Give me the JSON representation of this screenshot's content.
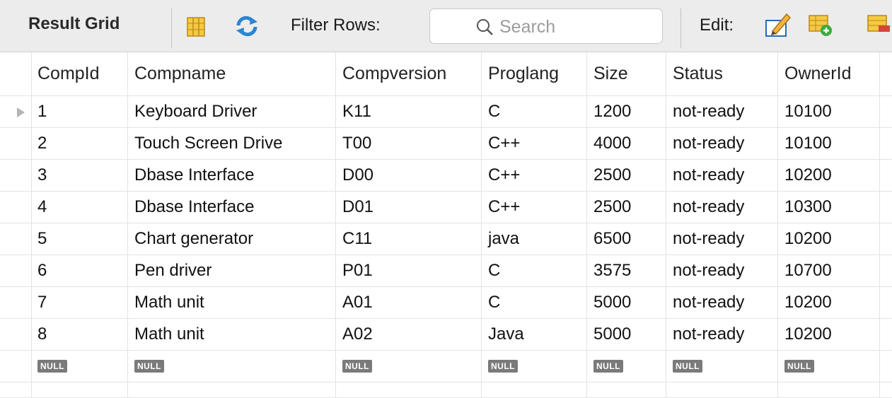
{
  "toolbar": {
    "title": "Result Grid",
    "filter_label": "Filter Rows:",
    "search_placeholder": "Search",
    "edit_label": "Edit:",
    "icons": [
      "grid-columns-icon",
      "refresh-icon",
      "search-icon",
      "edit-pencil-icon",
      "add-row-icon",
      "delete-row-icon"
    ]
  },
  "grid": {
    "columns": [
      "CompId",
      "Compname",
      "Compversion",
      "Proglang",
      "Size",
      "Status",
      "OwnerId"
    ],
    "rows": [
      [
        "1",
        "Keyboard Driver",
        "K11",
        "C",
        "1200",
        "not-ready",
        "10100"
      ],
      [
        "2",
        "Touch Screen Drive",
        "T00",
        "C++",
        "4000",
        "not-ready",
        "10100"
      ],
      [
        "3",
        "Dbase Interface",
        "D00",
        "C++",
        "2500",
        "not-ready",
        "10200"
      ],
      [
        "4",
        "Dbase Interface",
        "D01",
        "C++",
        "2500",
        "not-ready",
        "10300"
      ],
      [
        "5",
        "Chart generator",
        "C11",
        "java",
        "6500",
        "not-ready",
        "10200"
      ],
      [
        "6",
        "Pen driver",
        "P01",
        "C",
        "3575",
        "not-ready",
        "10700"
      ],
      [
        "7",
        "Math unit",
        "A01",
        "C",
        "5000",
        "not-ready",
        "10200"
      ],
      [
        "8",
        "Math unit",
        "A02",
        "Java",
        "5000",
        "not-ready",
        "10200"
      ]
    ],
    "null_label": "NULL"
  }
}
